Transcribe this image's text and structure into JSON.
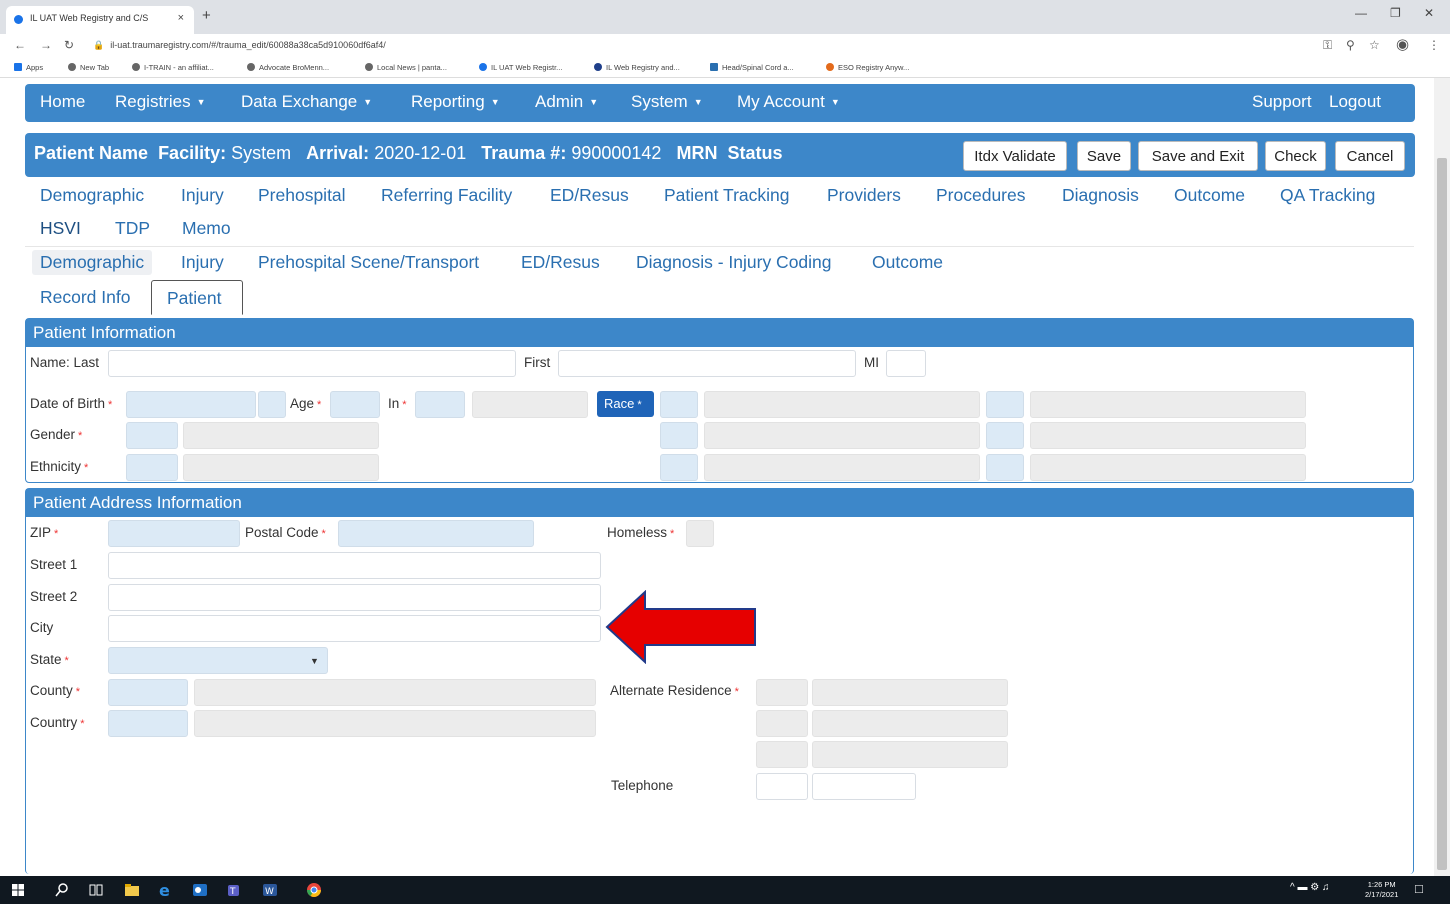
{
  "browser": {
    "tab_title": "IL UAT Web Registry and C/S",
    "tab_close": "×",
    "new_tab": "+",
    "url": "il-uat.traumaregistry.com/#/trauma_edit/60088a38ca5d910060df6af4/",
    "bookmarks": [
      "Apps",
      "New Tab",
      "I-TRAIN - an affiliat...",
      "Advocate BroMenn...",
      "Local News | panta...",
      "IL UAT Web Registr...",
      "IL Web Registry and...",
      "Head/Spinal Cord a...",
      "ESO Registry Anyw..."
    ]
  },
  "navbar": {
    "home": "Home",
    "registries": "Registries",
    "data_exchange": "Data Exchange",
    "reporting": "Reporting",
    "admin": "Admin",
    "system": "System",
    "my_account": "My Account",
    "support": "Support",
    "logout": "Logout"
  },
  "patient_bar": {
    "patient_name_label": "Patient Name",
    "facility_label": "Facility:",
    "facility_value": "System",
    "arrival_label": "Arrival:",
    "arrival_value": "2020-12-01",
    "trauma_label": "Trauma #:",
    "trauma_value": "990000142",
    "mrn_label": "MRN",
    "status_label": "Status",
    "buttons": {
      "itdx_validate": "Itdx Validate",
      "save": "Save",
      "save_exit": "Save and Exit",
      "check": "Check",
      "cancel": "Cancel"
    }
  },
  "main_tabs": [
    "Demographic",
    "Injury",
    "Prehospital",
    "Referring Facility",
    "ED/Resus",
    "Patient Tracking",
    "Providers",
    "Procedures",
    "Diagnosis",
    "Outcome",
    "QA Tracking",
    "HSVI",
    "TDP",
    "Memo"
  ],
  "sub_tabs": [
    "Demographic",
    "Injury",
    "Prehospital Scene/Transport",
    "ED/Resus",
    "Diagnosis - Injury Coding",
    "Outcome"
  ],
  "sub_sub_tabs": [
    "Record Info",
    "Patient"
  ],
  "patient_info": {
    "title": "Patient Information",
    "name_last": "Name: Last",
    "first": "First",
    "mi": "MI",
    "dob": "Date of Birth",
    "age": "Age",
    "in": "In",
    "race": "Race",
    "gender": "Gender",
    "ethnicity": "Ethnicity",
    "required": "*"
  },
  "address_info": {
    "title": "Patient Address Information",
    "zip": "ZIP",
    "postal_code": "Postal Code",
    "homeless": "Homeless",
    "street1": "Street 1",
    "street2": "Street 2",
    "city": "City",
    "state": "State",
    "county": "County",
    "country": "Country",
    "alternate_residence": "Alternate Residence",
    "telephone": "Telephone"
  },
  "taskbar": {
    "time": "1:26 PM",
    "date": "2/17/2021"
  },
  "colors": {
    "header_blue": "#3d87c9",
    "link_blue": "#2a6fb0",
    "required_red": "#e33",
    "arrow_red": "#e60000"
  }
}
